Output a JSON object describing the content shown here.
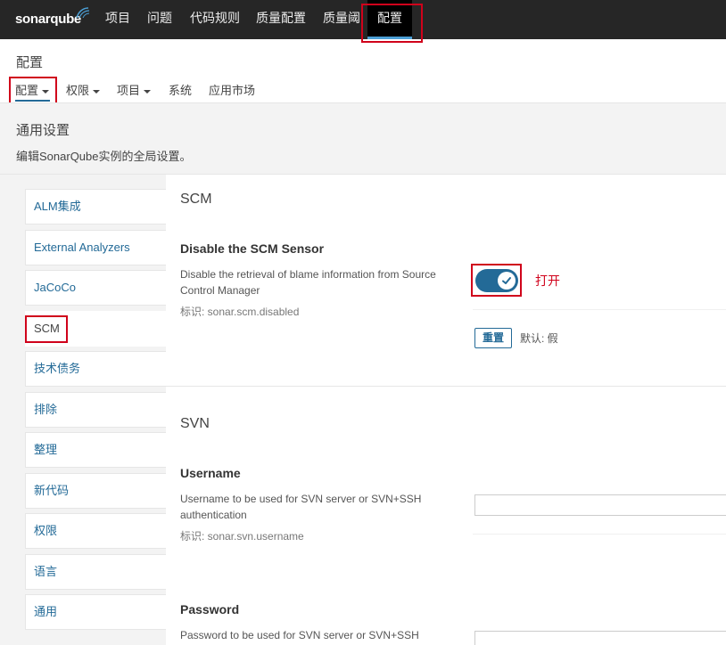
{
  "topnav": {
    "logo_text": "sonarqube",
    "items": [
      "项目",
      "问题",
      "代码规则",
      "质量配置",
      "质量阈",
      "配置"
    ]
  },
  "page": {
    "title": "配置"
  },
  "subnav": {
    "items": [
      "配置",
      "权限",
      "项目",
      "系统",
      "应用市场"
    ]
  },
  "section": {
    "title": "通用设置",
    "description": "编辑SonarQube实例的全局设置。"
  },
  "categories": [
    "ALM集成",
    "External Analyzers",
    "JaCoCo",
    "SCM",
    "技术债务",
    "排除",
    "整理",
    "新代码",
    "权限",
    "语言",
    "通用"
  ],
  "scm": {
    "group_title": "SCM",
    "disable_sensor": {
      "title": "Disable the SCM Sensor",
      "desc_line1": "Disable the retrieval of blame information from Source",
      "desc_line2": "Control Manager",
      "key": "标识: sonar.scm.disabled",
      "toggle_on": true,
      "annotation": "打开",
      "reset_label": "重置",
      "default_label": "默认: 假"
    }
  },
  "svn": {
    "group_title": "SVN",
    "username": {
      "title": "Username",
      "desc_line1": "Username to be used for SVN server or SVN+SSH",
      "desc_line2": "authentication",
      "key": "标识: sonar.svn.username",
      "value": ""
    },
    "password": {
      "title": "Password",
      "desc_line1": "Password to be used for SVN server or SVN+SSH",
      "value": ""
    }
  },
  "colors": {
    "accent": "#236a97",
    "highlight": "#d0021b",
    "topbar": "#262626"
  }
}
